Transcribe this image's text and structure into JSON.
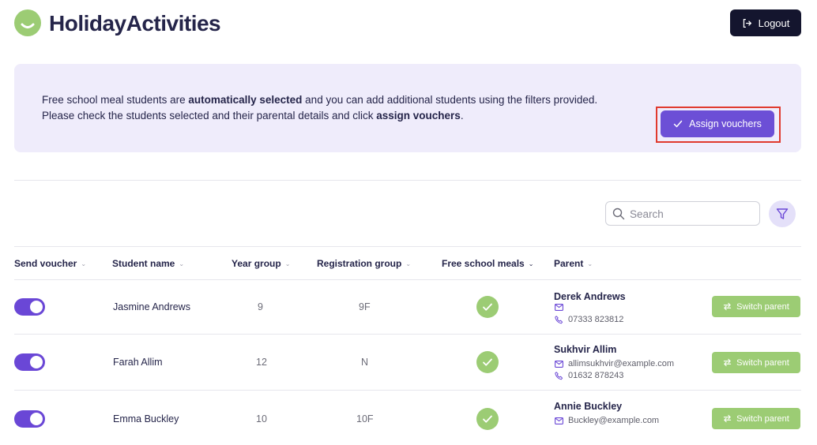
{
  "app": {
    "name": "HolidayActivities",
    "logout_label": "Logout"
  },
  "banner": {
    "text_1": "Free school meal students are ",
    "text_bold_1": "automatically selected",
    "text_2": " and you can add additional students using the filters provided. Please check the students selected and their parental details and click ",
    "text_bold_2": "assign vouchers",
    "text_3": ".",
    "assign_label": "Assign vouchers"
  },
  "search": {
    "placeholder": "Search"
  },
  "table": {
    "headers": {
      "send_voucher": "Send voucher",
      "student_name": "Student name",
      "year_group": "Year group",
      "registration_group": "Registration group",
      "free_school_meals": "Free school meals",
      "parent": "Parent"
    },
    "switch_label": "Switch parent",
    "rows": [
      {
        "send_voucher": true,
        "student_name": "Jasmine Andrews",
        "year_group": "9",
        "registration_group": "9F",
        "free_school_meals": true,
        "parent_name": "Derek Andrews",
        "parent_email": "",
        "parent_phone": "07333 823812"
      },
      {
        "send_voucher": true,
        "student_name": "Farah Allim",
        "year_group": "12",
        "registration_group": "N",
        "free_school_meals": true,
        "parent_name": "Sukhvir Allim",
        "parent_email": "allimsukhvir@example.com",
        "parent_phone": "01632 878243"
      },
      {
        "send_voucher": true,
        "student_name": "Emma Buckley",
        "year_group": "10",
        "registration_group": "10F",
        "free_school_meals": true,
        "parent_name": "Annie Buckley",
        "parent_email": "Buckley@example.com",
        "parent_phone": ""
      }
    ]
  },
  "colors": {
    "accent": "#6a47d6",
    "success": "#9ccc74",
    "banner_bg": "#efecfb",
    "dark": "#14152e",
    "highlight": "#e03a2e"
  },
  "icons": {
    "logo": "smile-logo-icon",
    "logout": "logout-icon",
    "assign": "check-icon",
    "search": "search-icon",
    "filter": "filter-icon",
    "meals": "check-circle-icon",
    "email": "mail-icon",
    "phone": "phone-icon",
    "switch": "swap-icon"
  }
}
